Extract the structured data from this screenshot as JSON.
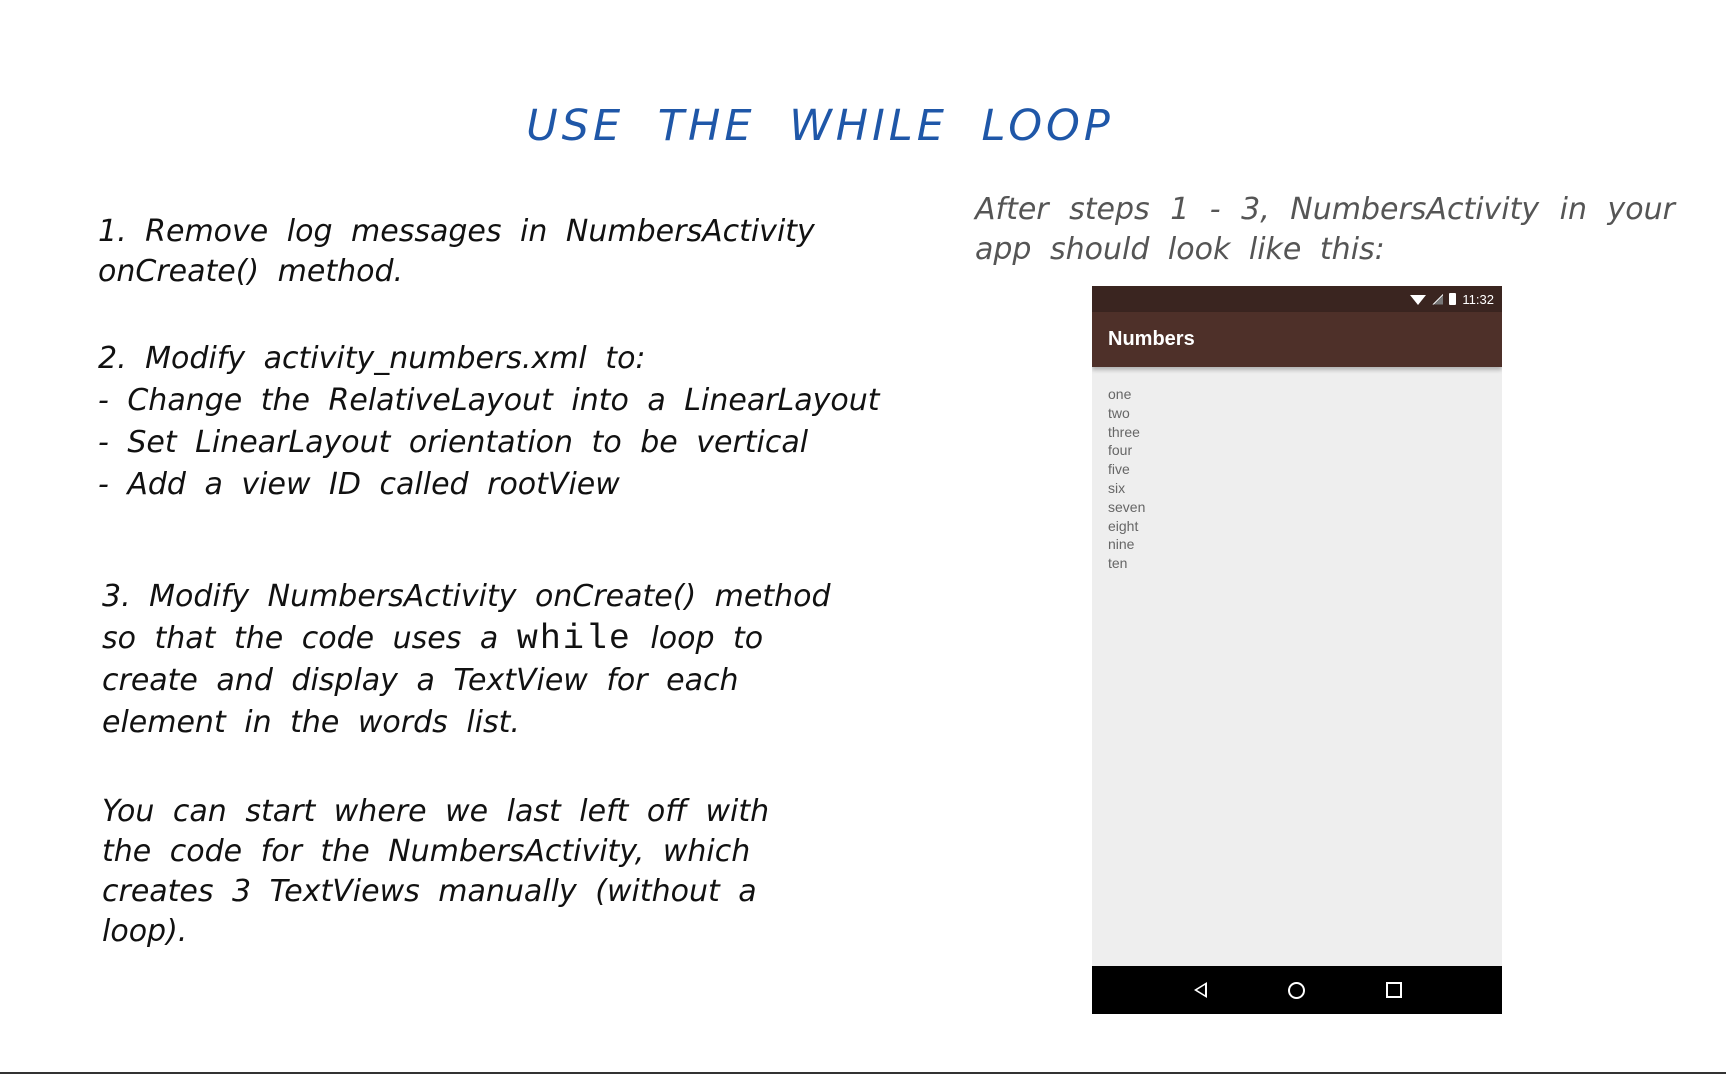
{
  "title": "USE THE WHILE LOOP",
  "steps": {
    "step1": [
      "1. Remove log messages in NumbersActivity",
      "onCreate() method."
    ],
    "step2": [
      "2. Modify activity_numbers.xml to:",
      "- Change the RelativeLayout into a LinearLayout",
      "- Set LinearLayout orientation to be vertical",
      "- Add a view ID called rootView"
    ],
    "step3": {
      "line1": "3. Modify NumbersActivity onCreate() method",
      "line2_before": "so that the code uses a ",
      "line2_code": "while",
      "line2_after": " loop to",
      "line3": "create and display a TextView for each",
      "line4": "element in the words list."
    },
    "note": [
      "You can start where we last left off with",
      "the code for the NumbersActivity, which",
      "creates 3 TextViews manually (without a",
      "loop)."
    ]
  },
  "caption": "After steps 1 - 3, NumbersActivity in your app should look like this:",
  "phone": {
    "status_time": "11:32",
    "app_title": "Numbers",
    "words": [
      "one",
      "two",
      "three",
      "four",
      "five",
      "six",
      "seven",
      "eight",
      "nine",
      "ten"
    ],
    "nav_icons": [
      "back-icon",
      "home-icon",
      "recents-icon"
    ],
    "status_bar_color": "#3a2520",
    "app_bar_color": "#4e3029"
  },
  "colors": {
    "title": "#1f57a8",
    "body_text": "#111111",
    "caption_text": "#555555"
  }
}
